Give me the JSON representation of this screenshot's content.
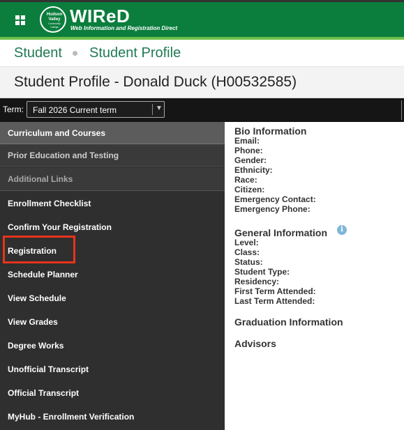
{
  "brand": {
    "seal_text": [
      "Hudson",
      "Valley",
      "Community",
      "College"
    ],
    "title": "WIReD",
    "subtitle": "Web Information and Registration Direct"
  },
  "breadcrumb": [
    "Student",
    "Student Profile"
  ],
  "page_title": "Student Profile - Donald Duck (H00532585)",
  "term": {
    "label": "Term:",
    "selected": "Fall 2026 Current term"
  },
  "sidebar": {
    "sections": [
      {
        "label": "Curriculum and Courses",
        "state": "active"
      },
      {
        "label": "Prior Education and Testing",
        "state": "normal"
      },
      {
        "label": "Additional Links",
        "state": "muted"
      }
    ],
    "links": [
      "Enrollment Checklist",
      "Confirm Your Registration",
      "Registration",
      "Schedule Planner",
      "View Schedule",
      "View Grades",
      "Degree Works",
      "Unofficial Transcript",
      "Official Transcript",
      "MyHub - Enrollment Verification"
    ],
    "highlighted_link": "Registration",
    "highlight_color": "#e8341c"
  },
  "bio": {
    "heading": "Bio Information",
    "fields": [
      "Email:",
      "Phone:",
      "Gender:",
      "Ethnicity:",
      "Race:",
      "Citizen:",
      "Emergency Contact:",
      "Emergency Phone:"
    ]
  },
  "general": {
    "heading": "General Information",
    "info_icon": "info-icon",
    "fields": [
      "Level:",
      "Class:",
      "Status:",
      "Student Type:",
      "Residency:",
      "First Term Attended:",
      "Last Term Attended:"
    ]
  },
  "graduation": {
    "heading": "Graduation Information"
  },
  "advisors": {
    "heading": "Advisors"
  },
  "colors": {
    "brand_green": "#0b7d3c",
    "accent_green": "#6fc04a",
    "link_green": "#1f7a53",
    "sidebar_bg": "#2f2f2f"
  }
}
